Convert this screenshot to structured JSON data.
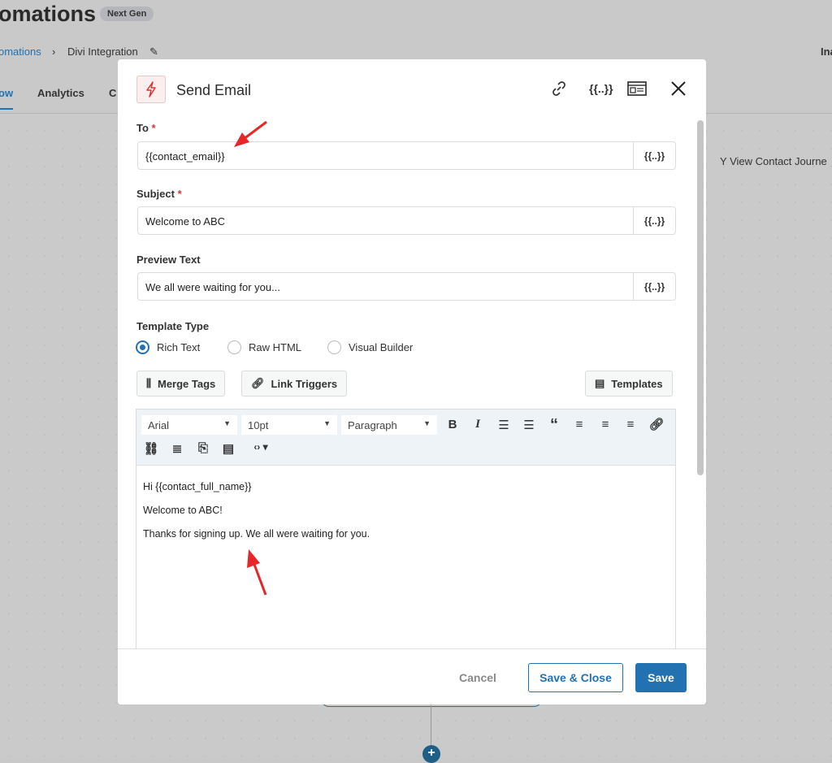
{
  "background": {
    "title": "omations",
    "badge": "Next Gen",
    "breadcrumb": [
      "omations",
      "Divi Integration"
    ],
    "tabs": [
      "ow",
      "Analytics",
      "C"
    ],
    "top_right": "Ina",
    "journey_link": "View Contact Journe"
  },
  "modal": {
    "title": "Send Email",
    "fields": [
      {
        "label": "To",
        "required": true,
        "value": "{{contact_email}}",
        "tag_button": "{{..}}"
      },
      {
        "label": "Subject",
        "required": true,
        "value": "Welcome to ABC",
        "tag_button": "{{..}}"
      },
      {
        "label": "Preview Text",
        "required": false,
        "value": "We all were waiting for you...",
        "tag_button": "{{..}}"
      }
    ],
    "template_type": {
      "label": "Template Type",
      "options": [
        "Rich Text",
        "Raw HTML",
        "Visual Builder"
      ],
      "selected": "Rich Text"
    },
    "buttons": {
      "merge_tags": "Merge Tags",
      "link_triggers": "Link Triggers",
      "templates": "Templates"
    },
    "editor": {
      "font": "Arial",
      "size": "10pt",
      "format": "Paragraph",
      "lines": [
        "Hi {{contact_full_name}}",
        "Welcome to ABC!",
        "Thanks for signing up. We all were waiting for you."
      ]
    },
    "footer": {
      "cancel": "Cancel",
      "save_close": "Save & Close",
      "save": "Save"
    },
    "header_merge": "{{..}}"
  },
  "colors": {
    "primary": "#2271b1",
    "accent_red": "#d63638",
    "arrow": "#e8262a"
  }
}
